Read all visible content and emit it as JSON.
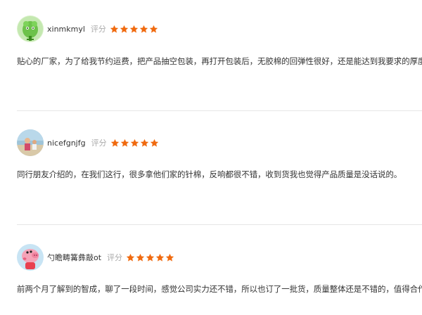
{
  "colors": {
    "star": "#f06a0f",
    "score_label": "#aaaaaa",
    "divider": "#e6e6e6"
  },
  "reviews": [
    {
      "username": "xinmkmyl",
      "score_label": "评分",
      "stars": 5,
      "avatar_icon": "green-cartoon-avatar-icon",
      "text": "贴心的厂家，为了给我节约运费，把产品抽空包装，再打开包装后，无胶棉的回弹性很好，还是能达到我要求的厚度。"
    },
    {
      "username": "nicefgnjfg",
      "score_label": "评分",
      "stars": 5,
      "avatar_icon": "photo-avatar-icon",
      "text": "同行朋友介绍的，在我们这行，很多拿他们家的针棉，反响都很不错，收到货我也觉得产品质量是没话说的。"
    },
    {
      "username": "勺瞻畴篝彝敲ot",
      "score_label": "评分",
      "stars": 5,
      "avatar_icon": "pink-pig-avatar-icon",
      "text": "前两个月了解到的智成，聊了一段时间，感觉公司实力还不错，所以也订了一批货，质量整体还是不错的，值得合作。"
    }
  ]
}
